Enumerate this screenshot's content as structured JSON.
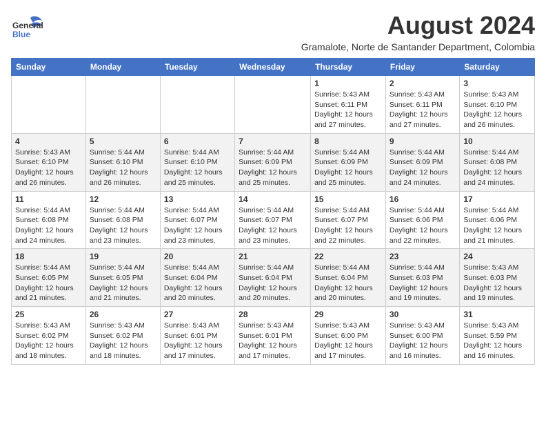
{
  "header": {
    "logo_general": "General",
    "logo_blue": "Blue",
    "title": "August 2024",
    "subtitle": "Gramalote, Norte de Santander Department, Colombia"
  },
  "calendar": {
    "days_of_week": [
      "Sunday",
      "Monday",
      "Tuesday",
      "Wednesday",
      "Thursday",
      "Friday",
      "Saturday"
    ],
    "weeks": [
      [
        {
          "day": "",
          "info": ""
        },
        {
          "day": "",
          "info": ""
        },
        {
          "day": "",
          "info": ""
        },
        {
          "day": "",
          "info": ""
        },
        {
          "day": "1",
          "info": "Sunrise: 5:43 AM\nSunset: 6:11 PM\nDaylight: 12 hours\nand 27 minutes."
        },
        {
          "day": "2",
          "info": "Sunrise: 5:43 AM\nSunset: 6:11 PM\nDaylight: 12 hours\nand 27 minutes."
        },
        {
          "day": "3",
          "info": "Sunrise: 5:43 AM\nSunset: 6:10 PM\nDaylight: 12 hours\nand 26 minutes."
        }
      ],
      [
        {
          "day": "4",
          "info": "Sunrise: 5:43 AM\nSunset: 6:10 PM\nDaylight: 12 hours\nand 26 minutes."
        },
        {
          "day": "5",
          "info": "Sunrise: 5:44 AM\nSunset: 6:10 PM\nDaylight: 12 hours\nand 26 minutes."
        },
        {
          "day": "6",
          "info": "Sunrise: 5:44 AM\nSunset: 6:10 PM\nDaylight: 12 hours\nand 25 minutes."
        },
        {
          "day": "7",
          "info": "Sunrise: 5:44 AM\nSunset: 6:09 PM\nDaylight: 12 hours\nand 25 minutes."
        },
        {
          "day": "8",
          "info": "Sunrise: 5:44 AM\nSunset: 6:09 PM\nDaylight: 12 hours\nand 25 minutes."
        },
        {
          "day": "9",
          "info": "Sunrise: 5:44 AM\nSunset: 6:09 PM\nDaylight: 12 hours\nand 24 minutes."
        },
        {
          "day": "10",
          "info": "Sunrise: 5:44 AM\nSunset: 6:08 PM\nDaylight: 12 hours\nand 24 minutes."
        }
      ],
      [
        {
          "day": "11",
          "info": "Sunrise: 5:44 AM\nSunset: 6:08 PM\nDaylight: 12 hours\nand 24 minutes."
        },
        {
          "day": "12",
          "info": "Sunrise: 5:44 AM\nSunset: 6:08 PM\nDaylight: 12 hours\nand 23 minutes."
        },
        {
          "day": "13",
          "info": "Sunrise: 5:44 AM\nSunset: 6:07 PM\nDaylight: 12 hours\nand 23 minutes."
        },
        {
          "day": "14",
          "info": "Sunrise: 5:44 AM\nSunset: 6:07 PM\nDaylight: 12 hours\nand 23 minutes."
        },
        {
          "day": "15",
          "info": "Sunrise: 5:44 AM\nSunset: 6:07 PM\nDaylight: 12 hours\nand 22 minutes."
        },
        {
          "day": "16",
          "info": "Sunrise: 5:44 AM\nSunset: 6:06 PM\nDaylight: 12 hours\nand 22 minutes."
        },
        {
          "day": "17",
          "info": "Sunrise: 5:44 AM\nSunset: 6:06 PM\nDaylight: 12 hours\nand 21 minutes."
        }
      ],
      [
        {
          "day": "18",
          "info": "Sunrise: 5:44 AM\nSunset: 6:05 PM\nDaylight: 12 hours\nand 21 minutes."
        },
        {
          "day": "19",
          "info": "Sunrise: 5:44 AM\nSunset: 6:05 PM\nDaylight: 12 hours\nand 21 minutes."
        },
        {
          "day": "20",
          "info": "Sunrise: 5:44 AM\nSunset: 6:04 PM\nDaylight: 12 hours\nand 20 minutes."
        },
        {
          "day": "21",
          "info": "Sunrise: 5:44 AM\nSunset: 6:04 PM\nDaylight: 12 hours\nand 20 minutes."
        },
        {
          "day": "22",
          "info": "Sunrise: 5:44 AM\nSunset: 6:04 PM\nDaylight: 12 hours\nand 20 minutes."
        },
        {
          "day": "23",
          "info": "Sunrise: 5:44 AM\nSunset: 6:03 PM\nDaylight: 12 hours\nand 19 minutes."
        },
        {
          "day": "24",
          "info": "Sunrise: 5:43 AM\nSunset: 6:03 PM\nDaylight: 12 hours\nand 19 minutes."
        }
      ],
      [
        {
          "day": "25",
          "info": "Sunrise: 5:43 AM\nSunset: 6:02 PM\nDaylight: 12 hours\nand 18 minutes."
        },
        {
          "day": "26",
          "info": "Sunrise: 5:43 AM\nSunset: 6:02 PM\nDaylight: 12 hours\nand 18 minutes."
        },
        {
          "day": "27",
          "info": "Sunrise: 5:43 AM\nSunset: 6:01 PM\nDaylight: 12 hours\nand 17 minutes."
        },
        {
          "day": "28",
          "info": "Sunrise: 5:43 AM\nSunset: 6:01 PM\nDaylight: 12 hours\nand 17 minutes."
        },
        {
          "day": "29",
          "info": "Sunrise: 5:43 AM\nSunset: 6:00 PM\nDaylight: 12 hours\nand 17 minutes."
        },
        {
          "day": "30",
          "info": "Sunrise: 5:43 AM\nSunset: 6:00 PM\nDaylight: 12 hours\nand 16 minutes."
        },
        {
          "day": "31",
          "info": "Sunrise: 5:43 AM\nSunset: 5:59 PM\nDaylight: 12 hours\nand 16 minutes."
        }
      ]
    ]
  }
}
